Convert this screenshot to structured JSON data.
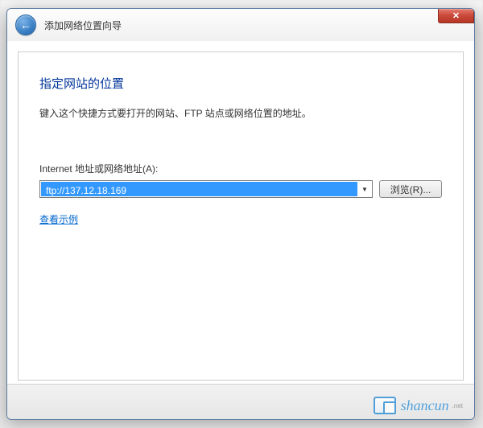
{
  "window": {
    "title": "添加网络位置向导",
    "close_hint": "Close"
  },
  "page": {
    "heading": "指定网站的位置",
    "description": "键入这个快捷方式要打开的网站、FTP 站点或网络位置的地址。"
  },
  "form": {
    "address_label": "Internet 地址或网络地址(A):",
    "address_value": "ftp://137.12.18.169",
    "browse_label": "浏览(R)...",
    "example_link": "查看示例"
  },
  "watermark": {
    "text": "shancun",
    "sub": ".net"
  }
}
